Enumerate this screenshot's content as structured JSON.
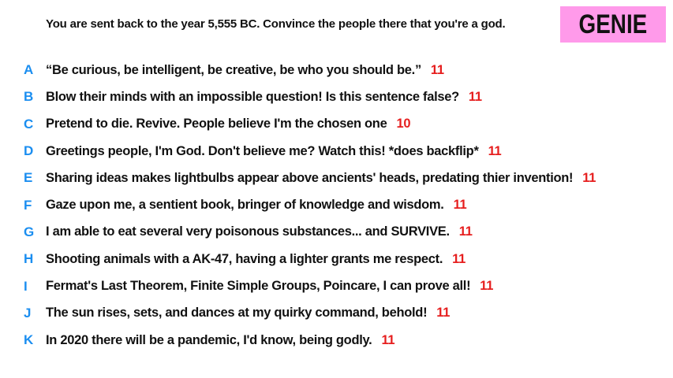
{
  "prompt": "You are sent back to the year 5,555 BC. Convince the people there that you're a god.",
  "badge": "GENIE",
  "colors": {
    "badge_bg": "#ff9aea",
    "letter": "#1b8ef0",
    "score": "#e61e1e",
    "text": "#111111"
  },
  "answers": [
    {
      "letter": "A",
      "text": "“Be curious, be intelligent, be creative, be who you should be.”",
      "score": "11"
    },
    {
      "letter": "B",
      "text": "Blow their minds with an impossible question! Is this sentence false?",
      "score": "11"
    },
    {
      "letter": "C",
      "text": "Pretend to die. Revive. People believe I'm the chosen one",
      "score": "10"
    },
    {
      "letter": "D",
      "text": "Greetings people, I'm God. Don't believe me? Watch this! *does backflip*",
      "score": "11"
    },
    {
      "letter": "E",
      "text": "Sharing ideas makes lightbulbs appear above ancients' heads, predating thier invention!",
      "score": "11"
    },
    {
      "letter": "F",
      "text": "Gaze upon me, a sentient book, bringer of knowledge and wisdom.",
      "score": "11"
    },
    {
      "letter": "G",
      "text": "I am able to eat several very poisonous substances... and SURVIVE.",
      "score": "11"
    },
    {
      "letter": "H",
      "text": "Shooting animals with a AK-47, having a lighter grants me respect.",
      "score": "11"
    },
    {
      "letter": "I",
      "text": "Fermat's Last Theorem, Finite Simple Groups, Poincare, I can prove all!",
      "score": "11"
    },
    {
      "letter": "J",
      "text": "The sun rises, sets, and dances at my quirky command, behold!",
      "score": "11"
    },
    {
      "letter": "K",
      "text": "In 2020 there will be a pandemic, I'd know, being godly.",
      "score": "11"
    }
  ]
}
